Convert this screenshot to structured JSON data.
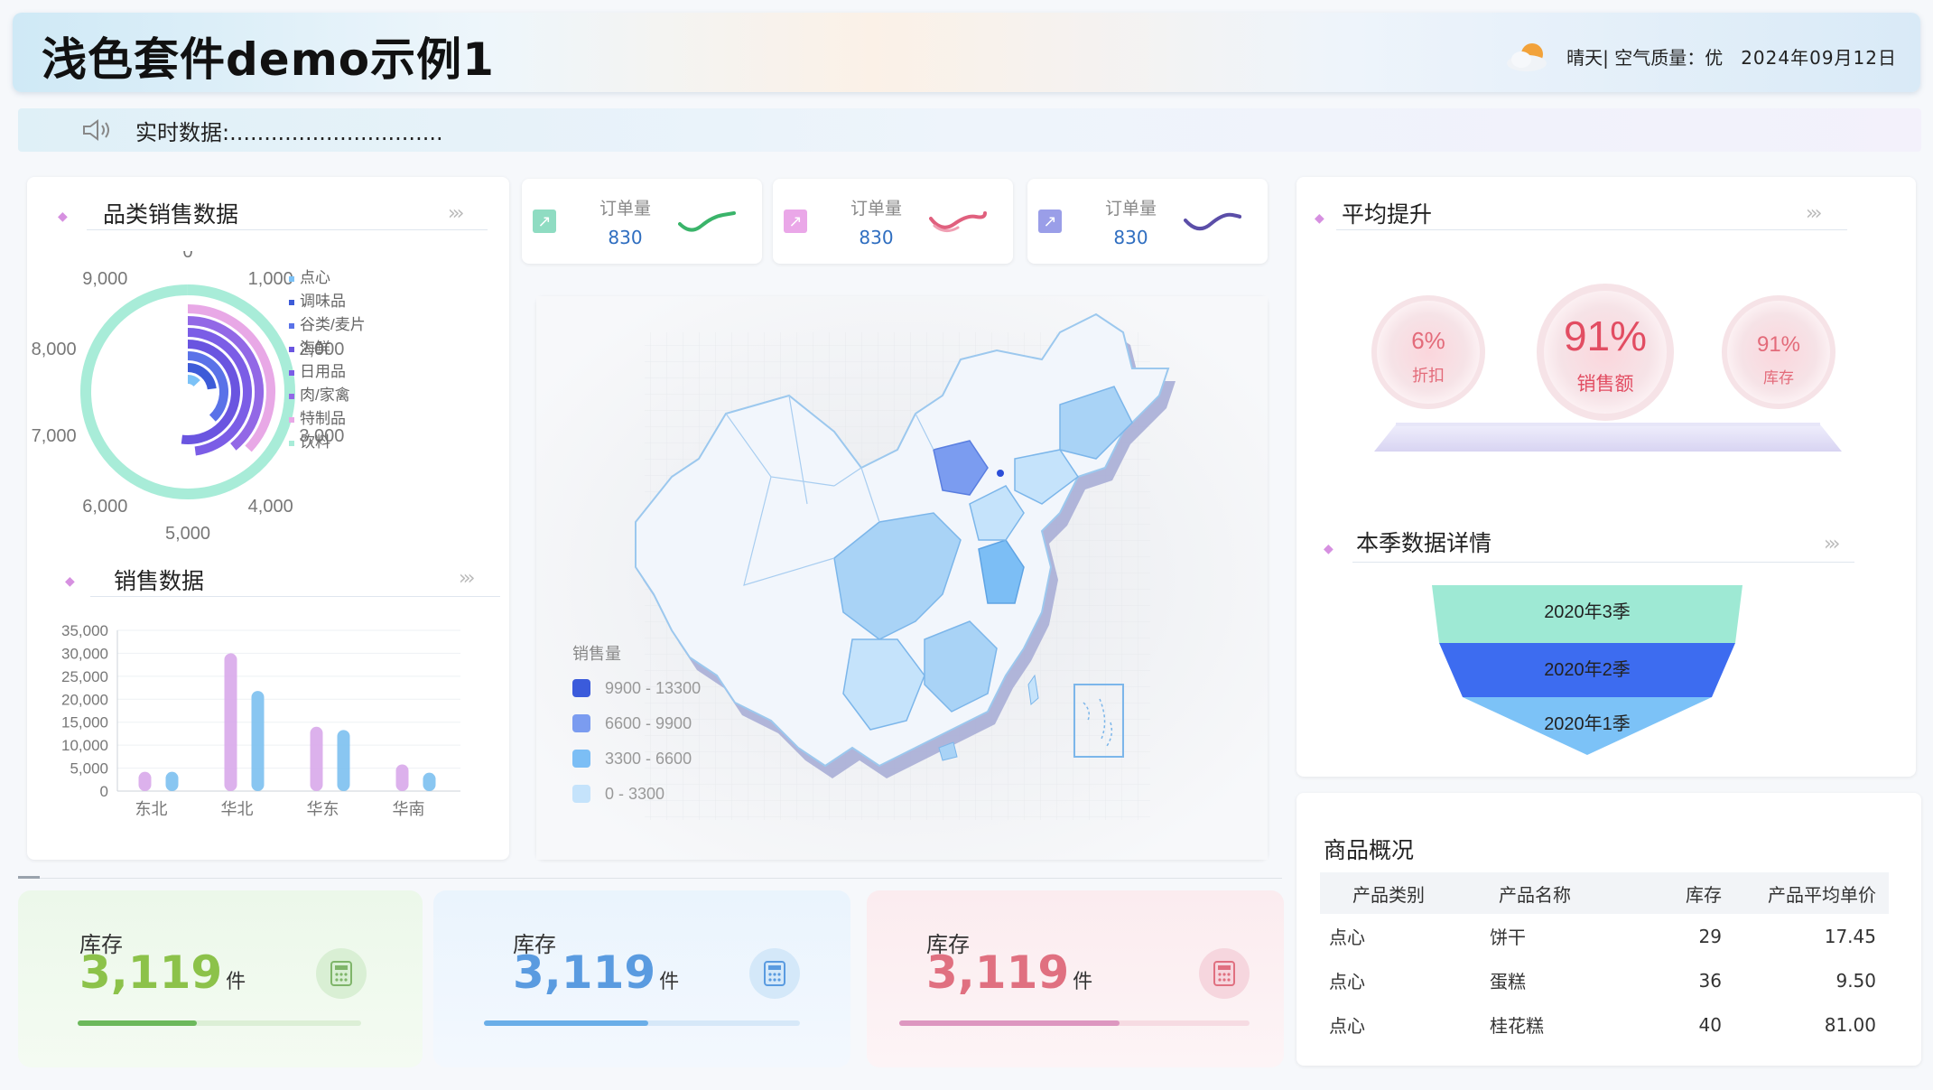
{
  "header": {
    "title": "浅色套件demo示例1",
    "weather": "晴天| 空气质量：优",
    "date": "2024年09月12日"
  },
  "ticker": {
    "text": "实时数据:..............................."
  },
  "category_panel": {
    "title": "品类销售数据"
  },
  "sales_panel": {
    "title": "销售数据"
  },
  "mini_cards": [
    {
      "label": "订单量",
      "value": "830",
      "icon_color": "#8fdcc2",
      "line_color": "#3ab46a"
    },
    {
      "label": "订单量",
      "value": "830",
      "icon_color": "#eaa7e8",
      "line_color": "#e0607e"
    },
    {
      "label": "订单量",
      "value": "830",
      "icon_color": "#9a9ee8",
      "line_color": "#5b4ea8"
    }
  ],
  "map_legend": {
    "title": "销售量",
    "items": [
      "9900 - 13300",
      "6600 - 9900",
      "3300 - 6600",
      "0 - 3300"
    ],
    "colors": [
      "#3b5bdb",
      "#7b9cf0",
      "#7cbef5",
      "#c5e3fb"
    ]
  },
  "uplift_panel": {
    "title": "平均提升",
    "circles": [
      {
        "value": "6%",
        "label": "折扣"
      },
      {
        "value": "91%",
        "label": "销售额"
      },
      {
        "value": "91%",
        "label": "库存"
      }
    ]
  },
  "season_panel": {
    "title": "本季数据详情",
    "stages": [
      "2020年3季",
      "2020年2季",
      "2020年1季"
    ],
    "stage_colors": [
      "#9ee9d4",
      "#3d6cf0",
      "#7cc2f7"
    ]
  },
  "kpis": [
    {
      "label": "库存",
      "value": "3,119",
      "unit": "件",
      "color": "#8cc24a",
      "progress": 0.42
    },
    {
      "label": "库存",
      "value": "3,119",
      "unit": "件",
      "color": "#5a9be0",
      "progress": 0.52
    },
    {
      "label": "库存",
      "value": "3,119",
      "unit": "件",
      "color": "#e07080",
      "progress": 0.63
    }
  ],
  "goods_panel": {
    "title": "商品概况",
    "columns": [
      "产品类别",
      "产品名称",
      "库存",
      "产品平均单价"
    ],
    "rows": [
      [
        "点心",
        "饼干",
        "29",
        "17.45"
      ],
      [
        "点心",
        "蛋糕",
        "36",
        "9.50"
      ],
      [
        "点心",
        "桂花糕",
        "40",
        "81.00"
      ]
    ]
  },
  "chart_data": [
    {
      "type": "radial-bar",
      "title": "品类销售数据",
      "angle_ticks": [
        "0",
        "1,000",
        "2,000",
        "3,000",
        "4,000",
        "5,000",
        "6,000",
        "7,000",
        "8,000",
        "9,000"
      ],
      "max": 10000,
      "categories": [
        "点心",
        "调味品",
        "谷类/麦片",
        "海鲜",
        "日用品",
        "肉/家禽",
        "特制品",
        "饮料"
      ],
      "colors": [
        "#7cc2f7",
        "#3d5bd8",
        "#5a72e8",
        "#6a55e0",
        "#7b5de6",
        "#9268e6",
        "#e8a8e6",
        "#a8ecd8"
      ],
      "values": [
        1300,
        2300,
        3800,
        5200,
        4800,
        3900,
        3700,
        10000
      ]
    },
    {
      "type": "bar",
      "title": "销售数据",
      "categories": [
        "东北",
        "华北",
        "华东",
        "华南"
      ],
      "ylim": [
        0,
        35000
      ],
      "yticks": [
        "35,000",
        "30,000",
        "25,000",
        "20,000",
        "15,000",
        "10,000",
        "5,000",
        "0"
      ],
      "series": [
        {
          "values": [
            4200,
            30000,
            14000,
            5800
          ],
          "color": "#d8a8ea"
        },
        {
          "values": [
            4200,
            21800,
            13300,
            4000
          ],
          "color": "#7cc0f0"
        }
      ]
    },
    {
      "type": "funnel",
      "categories": [
        "2020年3季",
        "2020年2季",
        "2020年1季"
      ]
    }
  ]
}
